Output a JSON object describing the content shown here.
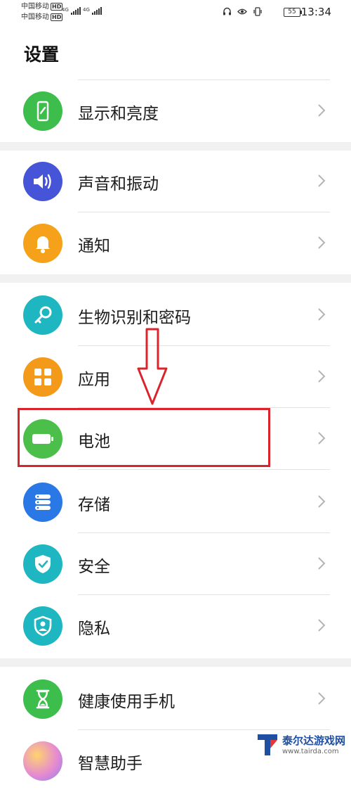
{
  "status_bar": {
    "carrier1": "中国移动",
    "carrier2": "中国移动",
    "hd": "HD",
    "net1": "4G",
    "net2": "4G",
    "battery": "55",
    "time": "13:34"
  },
  "page": {
    "title": "设置"
  },
  "items": [
    {
      "label": "显示和亮度",
      "color": "#3dbe4c",
      "icon": "phone-brightness-icon"
    },
    {
      "label": "声音和振动",
      "color": "#4655d8",
      "icon": "speaker-icon"
    },
    {
      "label": "通知",
      "color": "#f5a21a",
      "icon": "bell-icon"
    },
    {
      "label": "生物识别和密码",
      "color": "#1eb6c0",
      "icon": "key-icon"
    },
    {
      "label": "应用",
      "color": "#f39a1b",
      "icon": "apps-grid-icon"
    },
    {
      "label": "电池",
      "color": "#4cbf4a",
      "icon": "battery-icon"
    },
    {
      "label": "存储",
      "color": "#2a78e6",
      "icon": "storage-icon"
    },
    {
      "label": "安全",
      "color": "#1eb6c0",
      "icon": "shield-icon"
    },
    {
      "label": "隐私",
      "color": "#1eb6c0",
      "icon": "privacy-icon"
    },
    {
      "label": "健康使用手机",
      "color": "#3dbe4c",
      "icon": "hourglass-icon"
    },
    {
      "label": "智慧助手",
      "color": "#c96ee0",
      "icon": "assistant-icon"
    }
  ],
  "annotation": {
    "highlight_color": "#d9242c"
  },
  "watermark": {
    "name": "泰尔达游戏网",
    "url": "www.tairda.com"
  }
}
